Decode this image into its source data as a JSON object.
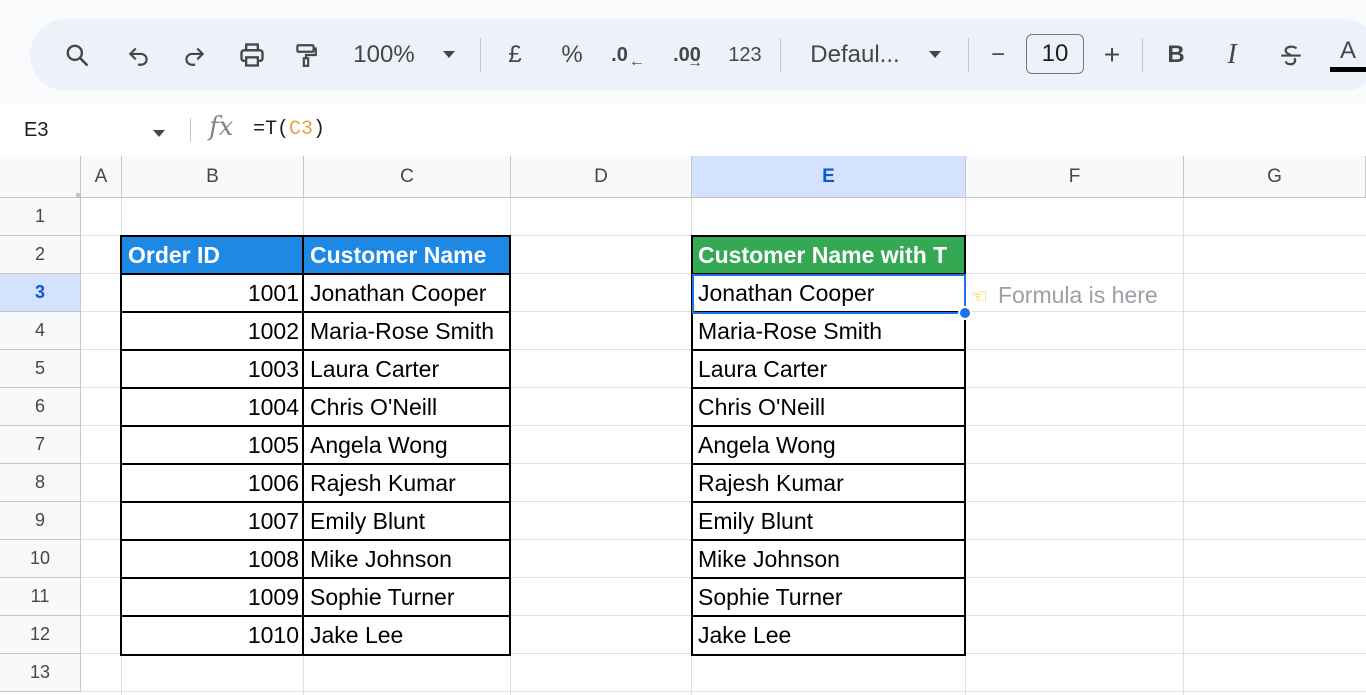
{
  "toolbar": {
    "zoom": "100%",
    "currency": "£",
    "percent": "%",
    "decrease_decimal": ".0",
    "increase_decimal": ".00",
    "number_format": "123",
    "font_name": "Defaul...",
    "font_size": "10",
    "minus": "−",
    "plus": "+",
    "bold": "B",
    "italic": "I",
    "text_color": "A"
  },
  "formula_bar": {
    "cell_ref": "E3",
    "fx": "fx",
    "formula_prefix": "=T(",
    "formula_ref": "C3",
    "formula_suffix": ")"
  },
  "columns": [
    "A",
    "B",
    "C",
    "D",
    "E",
    "F",
    "G"
  ],
  "rows": [
    "1",
    "2",
    "3",
    "4",
    "5",
    "6",
    "7",
    "8",
    "9",
    "10",
    "11",
    "12",
    "13"
  ],
  "table1": {
    "headers": [
      "Order ID",
      "Customer Name"
    ],
    "rows": [
      [
        "1001",
        "Jonathan Cooper"
      ],
      [
        "1002",
        "Maria-Rose Smith"
      ],
      [
        "1003",
        "Laura Carter"
      ],
      [
        "1004",
        "Chris O'Neill"
      ],
      [
        "1005",
        "Angela Wong"
      ],
      [
        "1006",
        "Rajesh Kumar"
      ],
      [
        "1007",
        "Emily Blunt"
      ],
      [
        "1008",
        "Mike Johnson"
      ],
      [
        "1009",
        "Sophie Turner"
      ],
      [
        "1010",
        "Jake Lee"
      ]
    ]
  },
  "table2": {
    "header": "Customer Name with T",
    "rows": [
      "Jonathan Cooper",
      "Maria-Rose Smith",
      "Laura Carter",
      "Chris O'Neill",
      "Angela Wong",
      "Rajesh Kumar",
      "Emily Blunt",
      "Mike Johnson",
      "Sophie Turner",
      "Jake Lee"
    ]
  },
  "note": "Formula is here",
  "colors": {
    "blue_header": "#1e88e5",
    "green_header": "#34a853",
    "selection": "#1a73e8"
  }
}
